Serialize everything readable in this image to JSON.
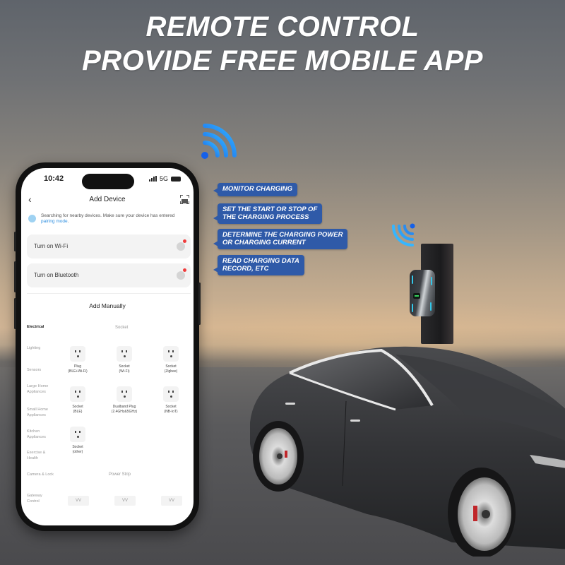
{
  "headline": {
    "line1": "REMOTE CONTROL",
    "line2": "PROVIDE FREE MOBILE APP"
  },
  "phone": {
    "status_bar": {
      "time": "10:42",
      "network": "5G"
    },
    "nav": {
      "back_icon": "chevron-left-icon",
      "title": "Add Device",
      "scan_icon": "scan-icon"
    },
    "searching": {
      "text": "Searching for nearby devices. Make sure your device has entered ",
      "link": "pairing mode",
      "suffix": "."
    },
    "toggles": [
      {
        "label": "Turn on Wi-Fi",
        "badge": true
      },
      {
        "label": "Turn on Bluetooth",
        "badge": true
      }
    ],
    "add_manually": "Add Manually",
    "categories": [
      {
        "label": "Electrical",
        "active": true
      },
      {
        "label": "Lighting",
        "active": false
      },
      {
        "label": "Sensors",
        "active": false
      },
      {
        "label": "Large Home Appliances",
        "active": false
      },
      {
        "label": "Small Home Appliances",
        "active": false
      },
      {
        "label": "Kitchen Appliances",
        "active": false
      },
      {
        "label": "Exercise & Health",
        "active": false
      },
      {
        "label": "Camera & Lock",
        "active": false
      },
      {
        "label": "Gateway Control",
        "active": false
      }
    ],
    "sections": {
      "socket": "Socket",
      "power_strip": "Power Strip"
    },
    "devices": [
      {
        "name": "Plug",
        "sub": "(BLE+Wi-Fi)"
      },
      {
        "name": "Socket",
        "sub": "(Wi-Fi)"
      },
      {
        "name": "Socket",
        "sub": "(Zigbee)"
      },
      {
        "name": "Socket",
        "sub": "(BLE)"
      },
      {
        "name": "Dualband Plug",
        "sub": "(2.4GHz&5GHz)"
      },
      {
        "name": "Socket",
        "sub": "(NB-IoT)"
      },
      {
        "name": "Socket",
        "sub": "(other)"
      }
    ],
    "power_strips": [
      "VV",
      "VV",
      "VV"
    ]
  },
  "features": [
    {
      "line1": "MONITOR CHARGING",
      "line2": ""
    },
    {
      "line1": "SET THE START OR STOP OF",
      "line2": "THE CHARGING PROCESS"
    },
    {
      "line1": "DETERMINE THE CHARGING POWER",
      "line2": "OR CHARGING CURRENT"
    },
    {
      "line1": "READ CHARGING DATA",
      "line2": "RECORD,  ETC"
    }
  ],
  "colors": {
    "bubble": "#2f5aa8",
    "wifi": "#1e90ff",
    "accent_link": "#2e8fe0",
    "badge": "#ef3b3b"
  }
}
